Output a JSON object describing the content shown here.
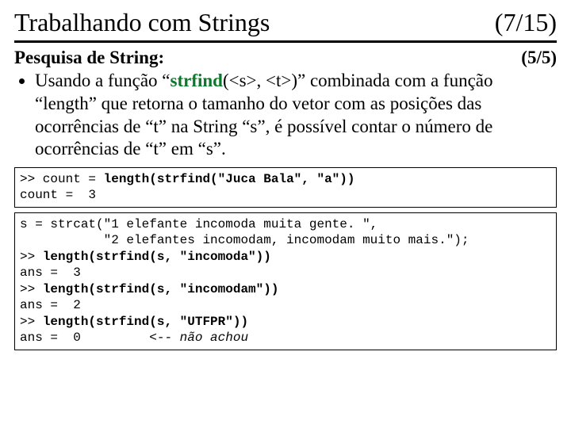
{
  "header": {
    "title": "Trabalhando com Strings",
    "pager": "(7/15)"
  },
  "subheader": {
    "title": "Pesquisa de String:",
    "pager": "(5/5)"
  },
  "bullet": {
    "pre": "Usando a função “",
    "fn": "strfind",
    "post": "(<s>, <t>)” combinada com a função “length” que retorna o tamanho do vetor com as posições das ocorrências de “t” na String “s”, é possível contar o número de ocorrências de “t” em “s”."
  },
  "code1": {
    "l1a": ">> count = ",
    "l1b": "length(strfind(\"Juca Bala\", \"a\"))",
    "l2": "count =  3"
  },
  "code2": {
    "l1": "s = strcat(\"1 elefante incomoda muita gente. \",",
    "l2": "           \"2 elefantes incomodam, incomodam muito mais.\");",
    "l3a": ">> ",
    "l3b": "length(strfind(s, \"incomoda\"))",
    "l4": "ans =  3",
    "l5a": ">> ",
    "l5b": "length(strfind(s, \"incomodam\"))",
    "l6": "ans =  2",
    "l7a": ">> ",
    "l7b": "length(strfind(s, \"UTFPR\"))",
    "l8a": "ans =  0         ",
    "l8b": "<-- não achou"
  }
}
